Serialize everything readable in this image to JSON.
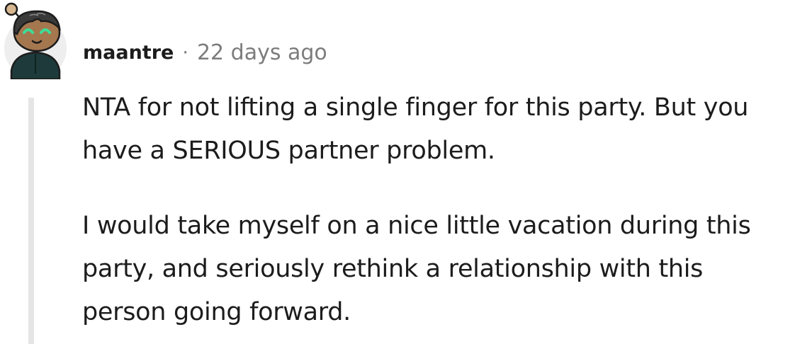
{
  "comment": {
    "username": "maantre",
    "separator": "·",
    "timestamp": "22 days ago",
    "paragraphs": [
      "NTA for not lifting a single finger for this party. But you have a SERIOUS partner problem.",
      "I would take myself on a nice little vacation during this party, and seriously rethink a relationship with this person going forward."
    ]
  },
  "colors": {
    "text": "#1c1c1c",
    "meta": "#7c7c7c",
    "thread_line": "#e5e5e5",
    "avatar_bg": "#eeeeee",
    "avatar_outfit": "#1f3a3a",
    "avatar_skin": "#a5774f",
    "avatar_eyes": "#3ddc97"
  }
}
